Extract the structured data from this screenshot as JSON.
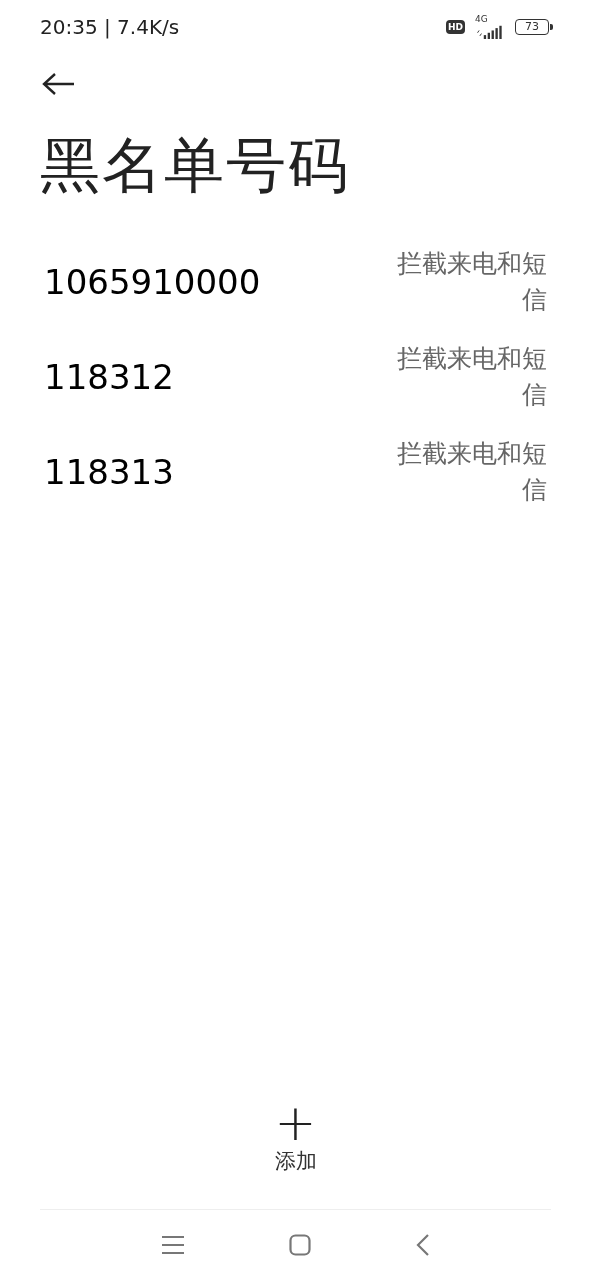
{
  "status_bar": {
    "time_speed": "20:35 | 7.4K/s",
    "hd": "HD",
    "network": "4G",
    "battery": "73"
  },
  "title": "黑名单号码",
  "numbers": [
    {
      "number": "1065910000",
      "mode": "拦截来电和短信"
    },
    {
      "number": "118312",
      "mode": "拦截来电和短信"
    },
    {
      "number": "118313",
      "mode": "拦截来电和短信"
    }
  ],
  "add_button": {
    "icon": "+",
    "label": "添加"
  }
}
